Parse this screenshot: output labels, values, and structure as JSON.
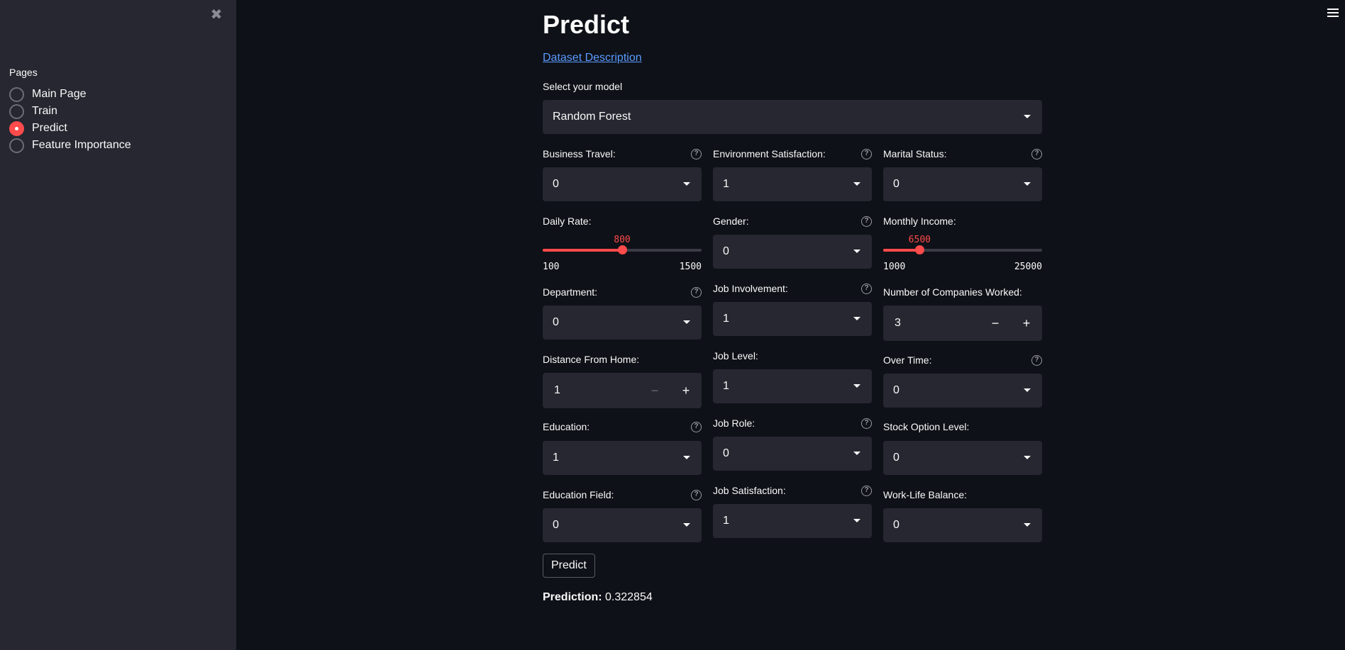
{
  "sidebar": {
    "close_glyph": "✖",
    "pages_label": "Pages",
    "items": [
      {
        "label": "Main Page",
        "selected": false
      },
      {
        "label": "Train",
        "selected": false
      },
      {
        "label": "Predict",
        "selected": true
      },
      {
        "label": "Feature Importance",
        "selected": false
      }
    ]
  },
  "header": {
    "title": "Predict",
    "dataset_link": "Dataset Description"
  },
  "model": {
    "label": "Select your model",
    "value": "Random Forest"
  },
  "fields": {
    "business_travel": {
      "label": "Business Travel:",
      "value": "0"
    },
    "environment_satisfaction": {
      "label": "Environment Satisfaction:",
      "value": "1"
    },
    "marital_status": {
      "label": "Marital Status:",
      "value": "0"
    },
    "daily_rate": {
      "label": "Daily Rate:",
      "value": 800,
      "min": 100,
      "max": 1500
    },
    "gender": {
      "label": "Gender:",
      "value": "0"
    },
    "monthly_income": {
      "label": "Monthly Income:",
      "value": 6500,
      "min": 1000,
      "max": 25000
    },
    "department": {
      "label": "Department:",
      "value": "0"
    },
    "job_involvement": {
      "label": "Job Involvement:",
      "value": "1"
    },
    "num_companies_worked": {
      "label": "Number of Companies Worked:",
      "value": "3"
    },
    "distance_from_home": {
      "label": "Distance From Home:",
      "value": "1"
    },
    "job_level": {
      "label": "Job Level:",
      "value": "1"
    },
    "over_time": {
      "label": "Over Time:",
      "value": "0"
    },
    "education": {
      "label": "Education:",
      "value": "1"
    },
    "job_role": {
      "label": "Job Role:",
      "value": "0"
    },
    "stock_option_level": {
      "label": "Stock Option Level:",
      "value": "0"
    },
    "education_field": {
      "label": "Education Field:",
      "value": "0"
    },
    "job_satisfaction": {
      "label": "Job Satisfaction:",
      "value": "1"
    },
    "work_life_balance": {
      "label": "Work-Life Balance:",
      "value": "0"
    }
  },
  "predict_button": "Predict",
  "prediction": {
    "label": "Prediction:",
    "value": "0.322854"
  },
  "colors": {
    "accent": "#ff4b4b",
    "background": "#0e1117",
    "sidebar": "#262730",
    "link": "#5b9bff"
  },
  "icons": {
    "help": "?",
    "minus": "−",
    "plus": "+"
  }
}
